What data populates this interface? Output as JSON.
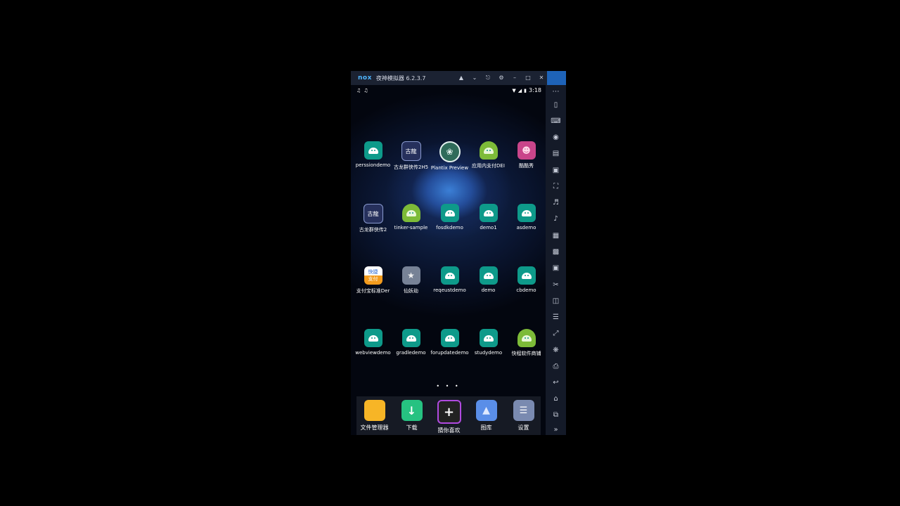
{
  "window": {
    "brand": "nox",
    "title": "夜神模拟器 6.2.3.7",
    "titlebar_icons": [
      "shirt-icon",
      "chevron-down-icon",
      "pin-icon",
      "gear-icon",
      "minimize-icon",
      "maximize-icon",
      "close-icon"
    ]
  },
  "status_bar": {
    "time": "3:18",
    "left_icons": [
      "tiktok-icon",
      "tiktok-icon"
    ],
    "right_icons": [
      "wifi-icon",
      "signal-icon",
      "battery-icon"
    ]
  },
  "apps": [
    {
      "label": "perssiondemo",
      "icon": "android-teal"
    },
    {
      "label": "古龙群侠传2H5",
      "icon": "gulong-game"
    },
    {
      "label": "Plantix Preview",
      "icon": "plantix"
    },
    {
      "label": "应用内支付DEI",
      "icon": "android-green"
    },
    {
      "label": "酷酷秀",
      "icon": "kukuxiu"
    },
    {
      "label": "古龙群侠传2",
      "icon": "gulong-game"
    },
    {
      "label": "tinker-sample",
      "icon": "android-green"
    },
    {
      "label": "fosdkdemo",
      "icon": "android-teal"
    },
    {
      "label": "demo1",
      "icon": "android-teal"
    },
    {
      "label": "asdemo",
      "icon": "android-teal"
    },
    {
      "label": "支付宝标准Der",
      "icon": "quickpay"
    },
    {
      "label": "仙妖劫",
      "icon": "xianyaojie"
    },
    {
      "label": "reqeustdemo",
      "icon": "android-teal"
    },
    {
      "label": "demo",
      "icon": "android-teal"
    },
    {
      "label": "cbdemo",
      "icon": "android-teal"
    },
    {
      "label": "webviewdemo",
      "icon": "android-teal"
    },
    {
      "label": "gradledemo",
      "icon": "android-teal"
    },
    {
      "label": "forupdatedemo",
      "icon": "android-teal"
    },
    {
      "label": "studydemo",
      "icon": "android-teal"
    },
    {
      "label": "快程软件商铺",
      "icon": "android-green"
    }
  ],
  "page_indicator": "• • •",
  "dock": [
    {
      "label": "文件管理器",
      "icon": "folder"
    },
    {
      "label": "下载",
      "icon": "download"
    },
    {
      "label": "猜你喜欢",
      "icon": "plus"
    },
    {
      "label": "图库",
      "icon": "gallery"
    },
    {
      "label": "设置",
      "icon": "settings"
    }
  ],
  "icon_text": {
    "quickpay_top": "快捷",
    "quickpay_bottom": "支付",
    "gulong": "古龍"
  },
  "sidebar_icons": [
    "more-icon",
    "phone-icon",
    "keyboard-icon",
    "location-icon",
    "storage-icon",
    "apk-icon",
    "fullscreen-icon",
    "volume-up-icon",
    "volume-down-icon",
    "toolbox-icon",
    "multi-instance-icon",
    "screenshot-icon",
    "cut-icon",
    "layout-icon",
    "menu-icon",
    "scale-icon",
    "loading-icon",
    "printer-icon",
    "back-icon",
    "home-icon",
    "recent-apps-icon",
    "expand-icon"
  ]
}
